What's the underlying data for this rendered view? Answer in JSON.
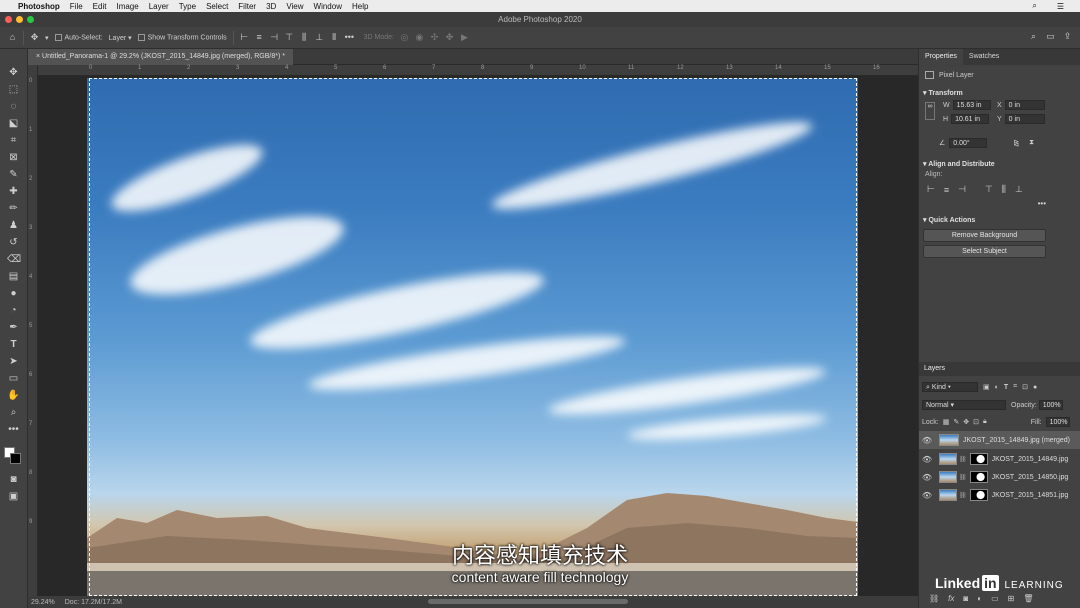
{
  "menubar": {
    "app": "Photoshop",
    "items": [
      "File",
      "Edit",
      "Image",
      "Layer",
      "Type",
      "Select",
      "Filter",
      "3D",
      "View",
      "Window",
      "Help"
    ]
  },
  "window": {
    "title": "Adobe Photoshop 2020"
  },
  "options": {
    "auto_select_label": "Auto-Select:",
    "auto_select_value": "Layer",
    "show_transform_label": "Show Transform Controls",
    "mode_3d_label": "3D Mode:"
  },
  "document": {
    "tab_label": "Untitled_Panorama-1 @ 29.2% (JKOST_2015_14849.jpg (merged), RGB/8*) *"
  },
  "ruler": {
    "h_ticks": [
      "0",
      "1",
      "2",
      "3",
      "4",
      "5",
      "6",
      "7",
      "8",
      "9",
      "10",
      "11",
      "12",
      "13",
      "14",
      "15",
      "16"
    ],
    "v_ticks": [
      "0",
      "1",
      "2",
      "3",
      "4",
      "5",
      "6",
      "7",
      "8",
      "9"
    ]
  },
  "status": {
    "zoom": "29.24%",
    "doc": "Doc: 17.2M/17.2M"
  },
  "properties": {
    "tab_properties": "Properties",
    "tab_swatches": "Swatches",
    "layer_type": "Pixel Layer",
    "transform_label": "Transform",
    "w_label": "W",
    "w_value": "15.63 in",
    "x_label": "X",
    "x_value": "0 in",
    "h_label": "H",
    "h_value": "10.61 in",
    "y_label": "Y",
    "y_value": "0 in",
    "angle_value": "0.00°",
    "align_label": "Align and Distribute",
    "align_sub": "Align:",
    "quick_actions_label": "Quick Actions",
    "remove_bg": "Remove Background",
    "select_subject": "Select Subject"
  },
  "layers": {
    "header": "Layers",
    "kind": "Kind",
    "blend": "Normal",
    "opacity_label": "Opacity:",
    "opacity_value": "100%",
    "lock_label": "Lock:",
    "fill_label": "Fill:",
    "fill_value": "100%",
    "items": [
      {
        "name": "JKOST_2015_14849.jpg (merged)"
      },
      {
        "name": "JKOST_2015_14849.jpg"
      },
      {
        "name": "JKOST_2015_14850.jpg"
      },
      {
        "name": "JKOST_2015_14851.jpg"
      }
    ]
  },
  "subtitles": {
    "zh": "内容感知填充技术",
    "en": "content aware fill technology"
  },
  "brand": {
    "linked": "Linked",
    "in": "in",
    "learning": "LEARNING"
  }
}
